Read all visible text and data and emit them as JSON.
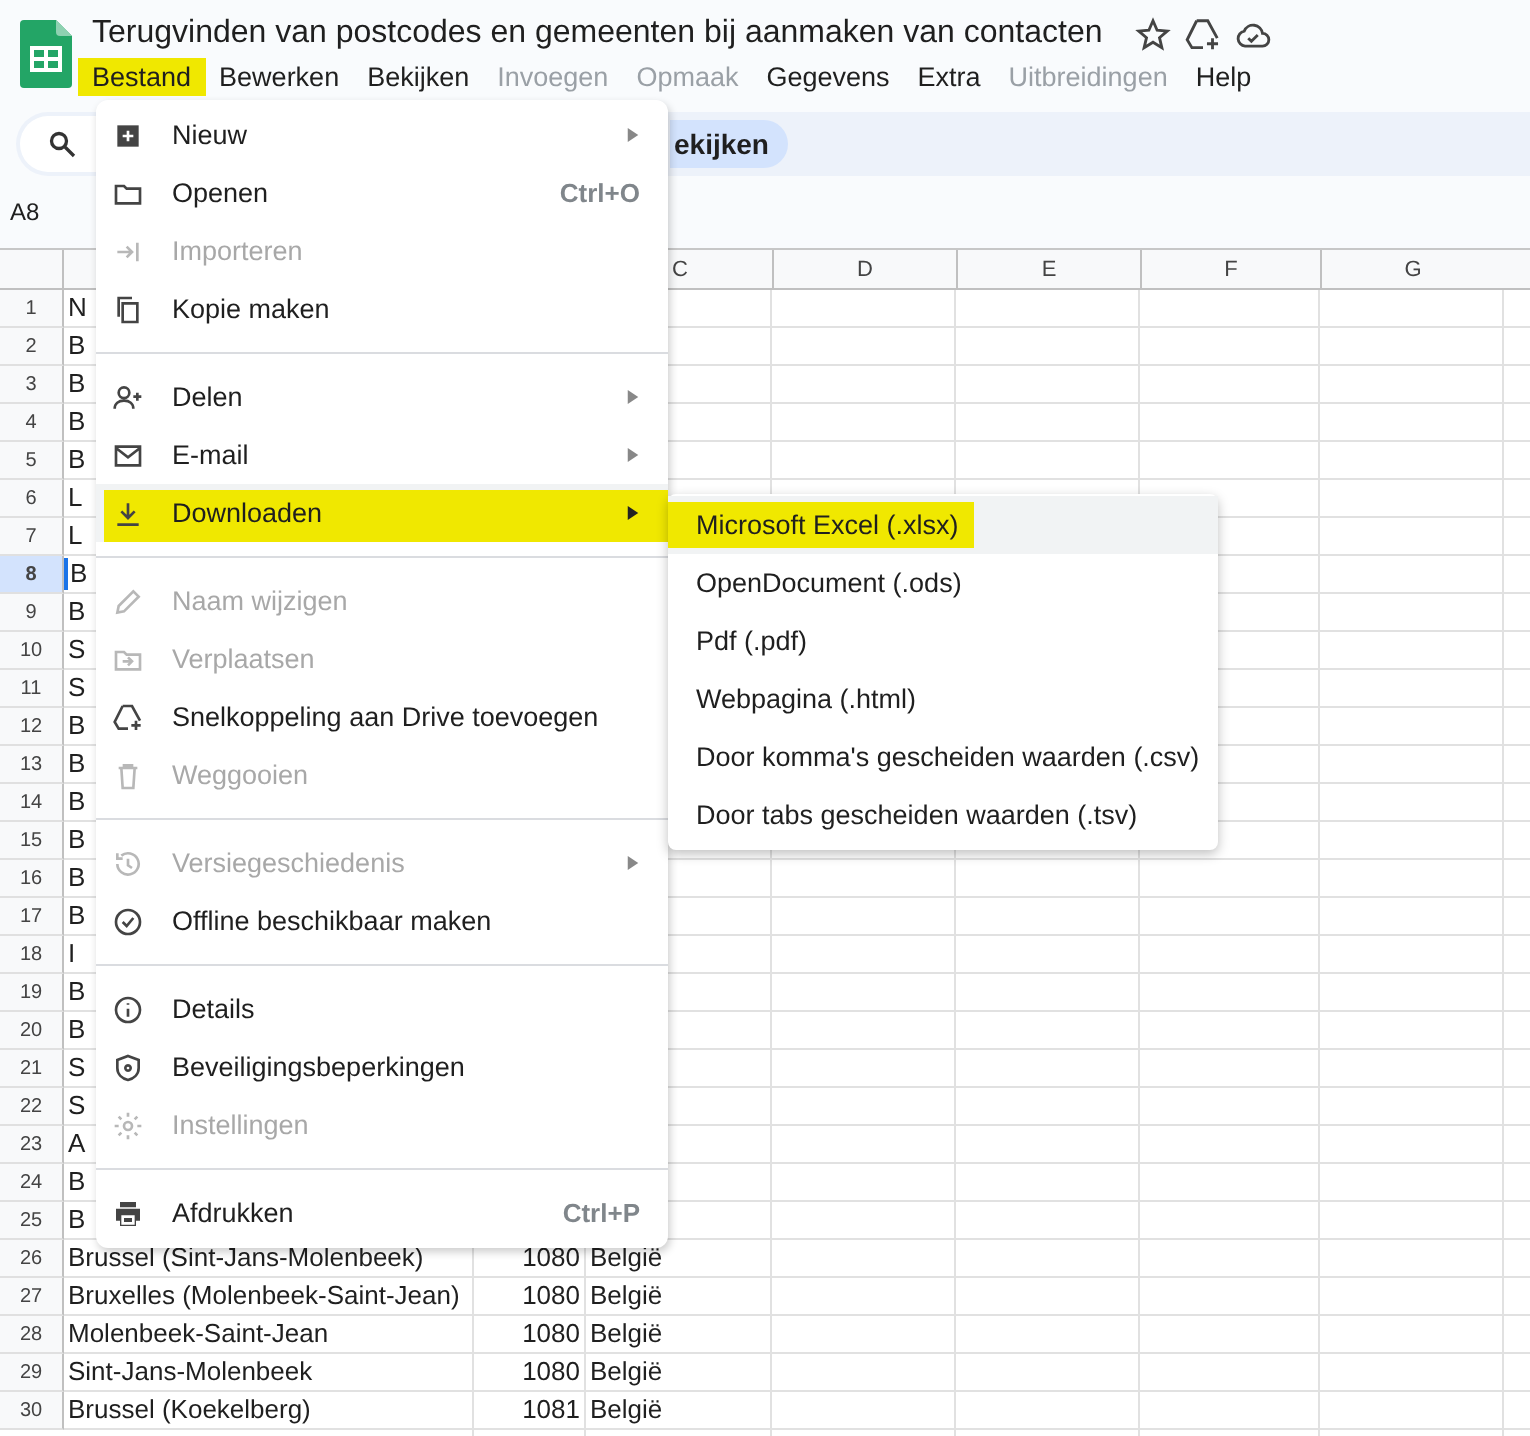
{
  "title": "Terugvinden van postcodes en gemeenten bij aanmaken van contacten",
  "menubar": [
    {
      "label": "Bestand",
      "disabled": false,
      "selected": true
    },
    {
      "label": "Bewerken",
      "disabled": false,
      "selected": false
    },
    {
      "label": "Bekijken",
      "disabled": false,
      "selected": false
    },
    {
      "label": "Invoegen",
      "disabled": true,
      "selected": false
    },
    {
      "label": "Opmaak",
      "disabled": true,
      "selected": false
    },
    {
      "label": "Gegevens",
      "disabled": false,
      "selected": false
    },
    {
      "label": "Extra",
      "disabled": false,
      "selected": false
    },
    {
      "label": "Uitbreidingen",
      "disabled": true,
      "selected": false
    },
    {
      "label": "Help",
      "disabled": false,
      "selected": false
    }
  ],
  "toolbar": {
    "chip": "ekijken"
  },
  "name_box": "A8",
  "columns": [
    "C",
    "D",
    "E",
    "F",
    "G"
  ],
  "rows": [
    {
      "number": "1",
      "selected": false,
      "cells": [
        "N"
      ]
    },
    {
      "number": "2",
      "selected": false,
      "cells": [
        "B"
      ]
    },
    {
      "number": "3",
      "selected": false,
      "cells": [
        "B"
      ]
    },
    {
      "number": "4",
      "selected": false,
      "cells": [
        "B"
      ]
    },
    {
      "number": "5",
      "selected": false,
      "cells": [
        "B"
      ]
    },
    {
      "number": "6",
      "selected": false,
      "cells": [
        "L"
      ]
    },
    {
      "number": "7",
      "selected": false,
      "cells": [
        "L"
      ]
    },
    {
      "number": "8",
      "selected": true,
      "cells": [
        "B"
      ]
    },
    {
      "number": "9",
      "selected": false,
      "cells": [
        "B"
      ]
    },
    {
      "number": "10",
      "selected": false,
      "cells": [
        "S"
      ]
    },
    {
      "number": "11",
      "selected": false,
      "cells": [
        "S"
      ]
    },
    {
      "number": "12",
      "selected": false,
      "cells": [
        "B"
      ]
    },
    {
      "number": "13",
      "selected": false,
      "cells": [
        "B"
      ]
    },
    {
      "number": "14",
      "selected": false,
      "cells": [
        "B"
      ]
    },
    {
      "number": "15",
      "selected": false,
      "cells": [
        "B"
      ]
    },
    {
      "number": "16",
      "selected": false,
      "cells": [
        "B"
      ]
    },
    {
      "number": "17",
      "selected": false,
      "cells": [
        "B"
      ]
    },
    {
      "number": "18",
      "selected": false,
      "cells": [
        "I"
      ]
    },
    {
      "number": "19",
      "selected": false,
      "cells": [
        "B"
      ]
    },
    {
      "number": "20",
      "selected": false,
      "cells": [
        "B"
      ]
    },
    {
      "number": "21",
      "selected": false,
      "cells": [
        "S"
      ]
    },
    {
      "number": "22",
      "selected": false,
      "cells": [
        "S"
      ]
    },
    {
      "number": "23",
      "selected": false,
      "cells": [
        "A"
      ]
    },
    {
      "number": "24",
      "selected": false,
      "cells": [
        "B"
      ]
    },
    {
      "number": "25",
      "selected": false,
      "cells": [
        "B"
      ]
    },
    {
      "number": "26",
      "selected": false,
      "cells": [
        "Brussel (Sint-Jans-Molenbeek)",
        "1080",
        "België"
      ]
    },
    {
      "number": "27",
      "selected": false,
      "cells": [
        "Bruxelles (Molenbeek-Saint-Jean)",
        "1080",
        "België"
      ]
    },
    {
      "number": "28",
      "selected": false,
      "cells": [
        "Molenbeek-Saint-Jean",
        "1080",
        "België"
      ]
    },
    {
      "number": "29",
      "selected": false,
      "cells": [
        "Sint-Jans-Molenbeek",
        "1080",
        "België"
      ]
    },
    {
      "number": "30",
      "selected": false,
      "cells": [
        "Brussel (Koekelberg)",
        "1081",
        "België"
      ]
    }
  ],
  "file_menu": [
    [
      {
        "label": "Nieuw",
        "disabled": false,
        "has_submenu": true,
        "selected": false
      },
      {
        "label": "Openen",
        "disabled": false,
        "has_submenu": false,
        "shortcut": "Ctrl+O",
        "selected": false
      },
      {
        "label": "Importeren",
        "disabled": true,
        "has_submenu": false,
        "selected": false
      },
      {
        "label": "Kopie maken",
        "disabled": false,
        "has_submenu": false,
        "selected": false
      }
    ],
    [
      {
        "label": "Delen",
        "disabled": false,
        "has_submenu": true,
        "selected": false
      },
      {
        "label": "E-mail",
        "disabled": false,
        "has_submenu": true,
        "selected": false
      },
      {
        "label": "Downloaden",
        "disabled": false,
        "has_submenu": true,
        "selected": true
      }
    ],
    [
      {
        "label": "Naam wijzigen",
        "disabled": true,
        "has_submenu": false,
        "selected": false
      },
      {
        "label": "Verplaatsen",
        "disabled": true,
        "has_submenu": false,
        "selected": false
      },
      {
        "label": "Snelkoppeling aan Drive toevoegen",
        "disabled": false,
        "has_submenu": false,
        "selected": false
      },
      {
        "label": "Weggooien",
        "disabled": true,
        "has_submenu": false,
        "selected": false
      }
    ],
    [
      {
        "label": "Versiegeschiedenis",
        "disabled": true,
        "has_submenu": true,
        "selected": false
      },
      {
        "label": "Offline beschikbaar maken",
        "disabled": false,
        "has_submenu": false,
        "selected": false
      }
    ],
    [
      {
        "label": "Details",
        "disabled": false,
        "has_submenu": false,
        "selected": false
      },
      {
        "label": "Beveiligingsbeperkingen",
        "disabled": false,
        "has_submenu": false,
        "selected": false
      },
      {
        "label": "Instellingen",
        "disabled": true,
        "has_submenu": false,
        "selected": false
      }
    ],
    [
      {
        "label": "Afdrukken",
        "disabled": false,
        "has_submenu": false,
        "shortcut": "Ctrl+P",
        "selected": false
      }
    ]
  ],
  "download_submenu": [
    {
      "label": "Microsoft Excel (.xlsx)",
      "selected": true,
      "marked": true
    },
    {
      "label": "OpenDocument (.ods)",
      "selected": false,
      "marked": false
    },
    {
      "label": "Pdf (.pdf)",
      "selected": false,
      "marked": false
    },
    {
      "label": "Webpagina (.html)",
      "selected": false,
      "marked": false
    },
    {
      "label": "Door komma's gescheiden waarden (.csv)",
      "selected": false,
      "marked": false
    },
    {
      "label": "Door tabs gescheiden waarden (.tsv)",
      "selected": false,
      "marked": false
    }
  ]
}
